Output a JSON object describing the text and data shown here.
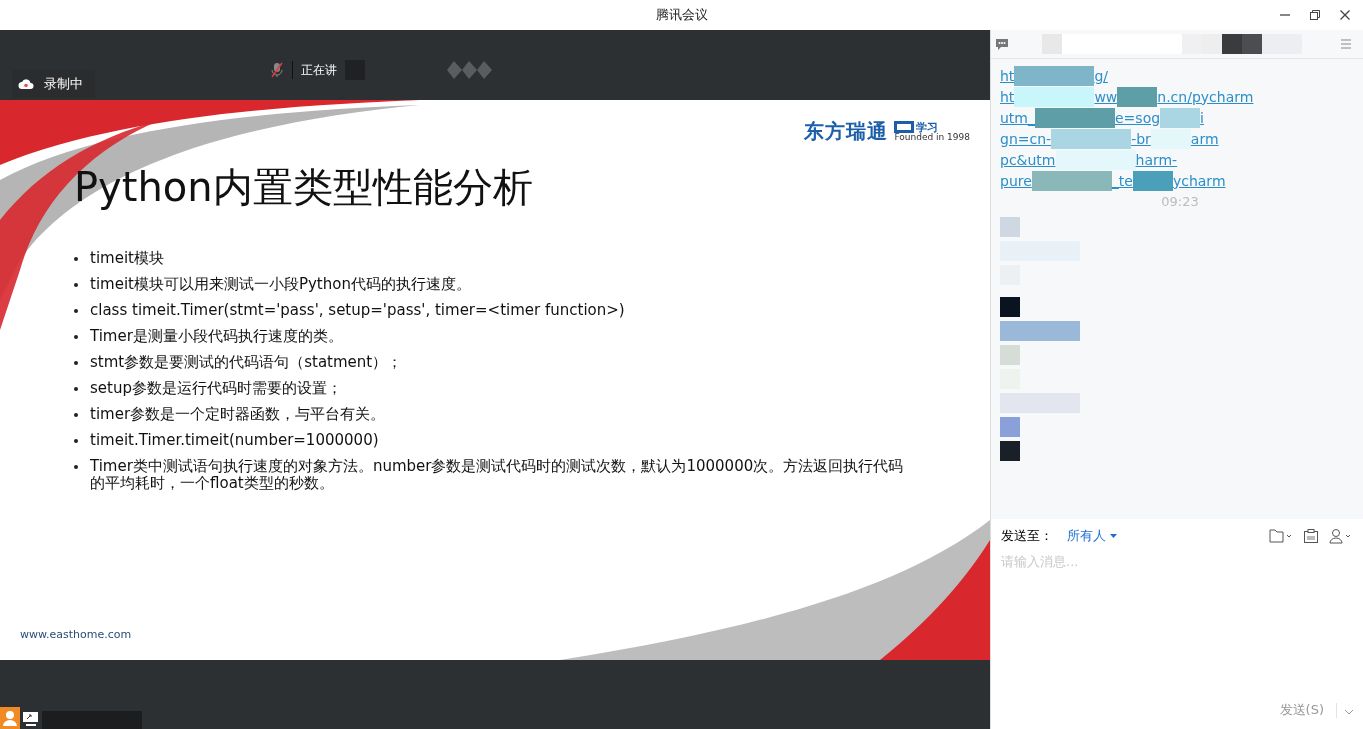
{
  "window": {
    "title": "腾讯会议"
  },
  "meeting": {
    "recording_label": "录制中",
    "speaker_label": "正在讲",
    "mic_muted": true
  },
  "slide": {
    "title": "Python内置类型性能分析",
    "logo": {
      "name": "东方瑞通",
      "badge": "学习",
      "tagline": "Founded in 1998"
    },
    "bullets": [
      "timeit模块",
      "timeit模块可以用来测试一小段Python代码的执行速度。",
      "class timeit.Timer(stmt='pass', setup='pass', timer=<timer function>)",
      "Timer是测量小段代码执行速度的类。",
      "stmt参数是要测试的代码语句（statment）；",
      "setup参数是运行代码时需要的设置；",
      "timer参数是一个定时器函数，与平台有关。",
      "timeit.Timer.timeit(number=1000000)",
      "Timer类中测试语句执行速度的对象方法。number参数是测试代码时的测试次数，默认为1000000次。方法返回执行代码的平均耗时，一个float类型的秒数。"
    ],
    "footer": "www.easthome.com"
  },
  "chat": {
    "link_lines": [
      [
        "ht",
        "g/"
      ],
      [
        "ht",
        "ww",
        "n.cn/pycharm"
      ],
      [
        "utm_",
        "e=sog",
        "i"
      ],
      [
        "gn=cn-",
        "-br",
        "arm"
      ],
      [
        "pc&utm",
        "harm-"
      ],
      [
        "pure",
        "_te",
        "ycharm"
      ]
    ],
    "timestamp": "09:23",
    "send_to_label": "发送至：",
    "recipient": "所有人",
    "placeholder": "请输入消息...",
    "send_button": "发送(S)"
  }
}
